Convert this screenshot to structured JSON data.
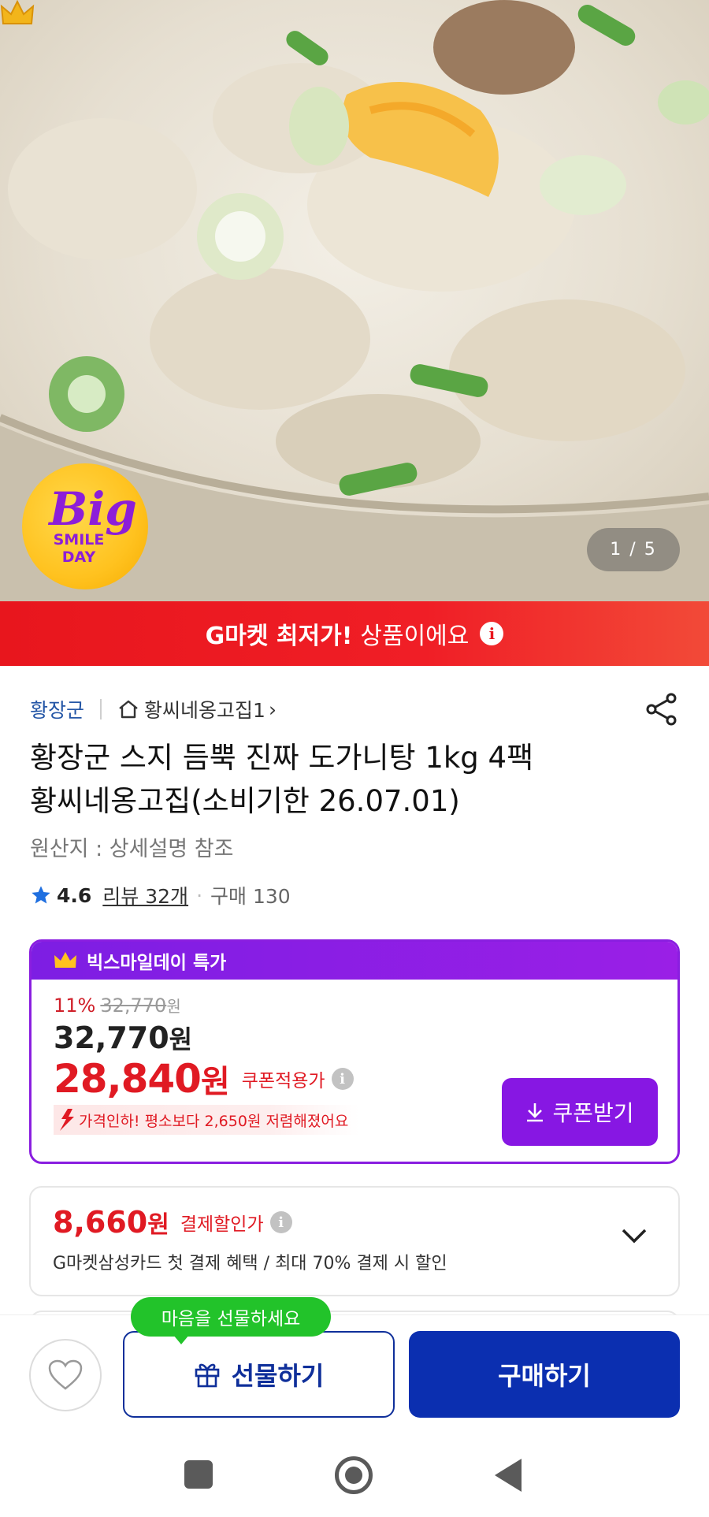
{
  "hero": {
    "image_desc": "beef-tendon-soup-photo",
    "badge": {
      "line1": "Big",
      "line2": "SMILE",
      "line3": "DAY"
    },
    "image_counter": "1 / 5"
  },
  "banner": {
    "strong": "G마켓 최저가!",
    "normal": "상품이에요",
    "info_icon": "info-icon"
  },
  "seller": {
    "brand": "황장군",
    "store": "황씨네옹고집1",
    "store_chevron": "›"
  },
  "product": {
    "title_line1": "황장군 스지 듬뿍 진짜 도가니탕 1kg 4팩",
    "title_line2": "황씨네옹고집(소비기한 26.07.01)",
    "origin": "원산지 : 상세설명 참조",
    "rating": "4.6",
    "reviews": "리뷰 32개",
    "purchases": "구매 130"
  },
  "deal": {
    "header": "빅스마일데이 특가",
    "discount_pct": "11%",
    "original_price": "32,770",
    "original_won": "원",
    "price": "32,770",
    "price_won": "원",
    "coupon_price": "28,840",
    "coupon_won": "원",
    "coupon_label": "쿠폰적용가",
    "price_drop_note": "가격인하! 평소보다 2,650원 저렴해졌어요",
    "coupon_button": "쿠폰받기"
  },
  "payment": {
    "price": "8,660",
    "won": "원",
    "label": "결제할인가",
    "desc": "G마켓삼성카드 첫 결제 혜택 / 최대 70% 결제 시 할인"
  },
  "actions": {
    "tooltip": "마음을 선물하세요",
    "gift": "선물하기",
    "buy": "구매하기"
  },
  "colors": {
    "brand_red": "#e8161d",
    "deal_purple": "#8717e3",
    "buy_blue": "#0b2fb0",
    "tooltip_green": "#22c32a"
  }
}
